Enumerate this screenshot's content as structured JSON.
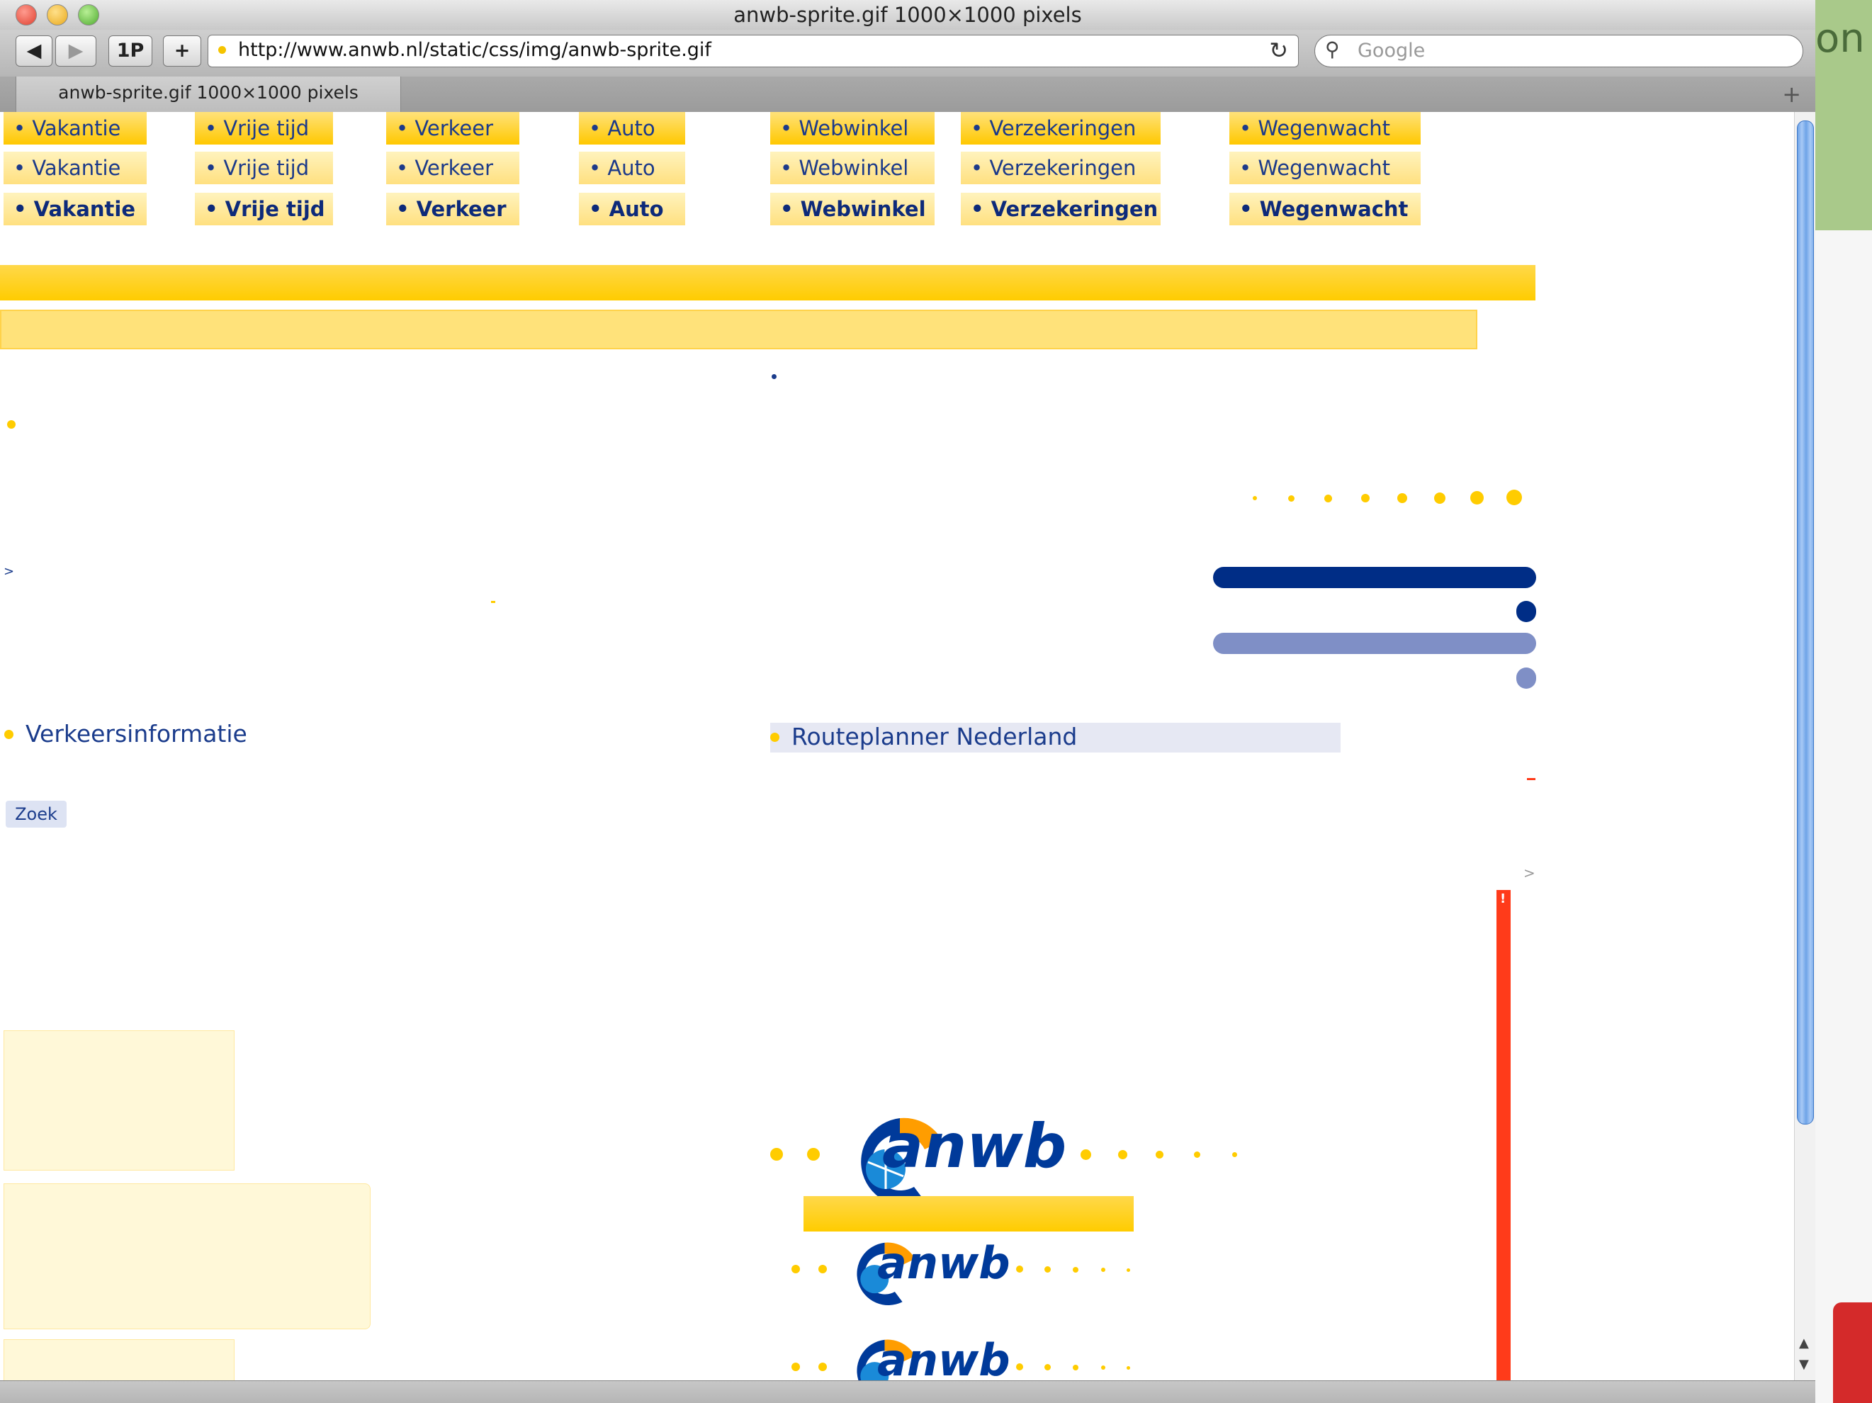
{
  "window": {
    "title": "anwb-sprite.gif 1000×1000 pixels",
    "url": "http://www.anwb.nl/static/css/img/anwb-sprite.gif",
    "search_placeholder": "Google",
    "tab_title": "anwb-sprite.gif 1000×1000 pixels",
    "toolbar": {
      "back_label": "◀",
      "forward_label": "▶",
      "1p_label": "1P",
      "add_label": "+"
    }
  },
  "backdrop": {
    "partial_text": "on"
  },
  "sprite": {
    "nav_rows": [
      [
        "• Vakantie",
        "• Vrije tijd",
        "• Verkeer",
        "• Auto",
        "• Webwinkel",
        "• Verzekeringen",
        "• Wegenwacht"
      ],
      [
        "• Vakantie",
        "• Vrije tijd",
        "• Verkeer",
        "• Auto",
        "• Webwinkel",
        "• Verzekeringen",
        "• Wegenwacht"
      ],
      [
        "• Vakantie",
        "• Vrije tijd",
        "• Verkeer",
        "• Auto",
        "• Webwinkel",
        "• Verzekeringen",
        "• Wegenwacht"
      ]
    ],
    "verkeersinformatie_label": "Verkeersinformatie",
    "routeplanner_label": "Routeplanner Nederland",
    "zoek_label": "Zoek",
    "logo_text": "anwb",
    "arrow_small": ">",
    "alert_mark": "!"
  },
  "colors": {
    "brand_yellow": "#ffcc00",
    "brand_navy": "#002d86",
    "alert_red": "#ff3b1a"
  }
}
